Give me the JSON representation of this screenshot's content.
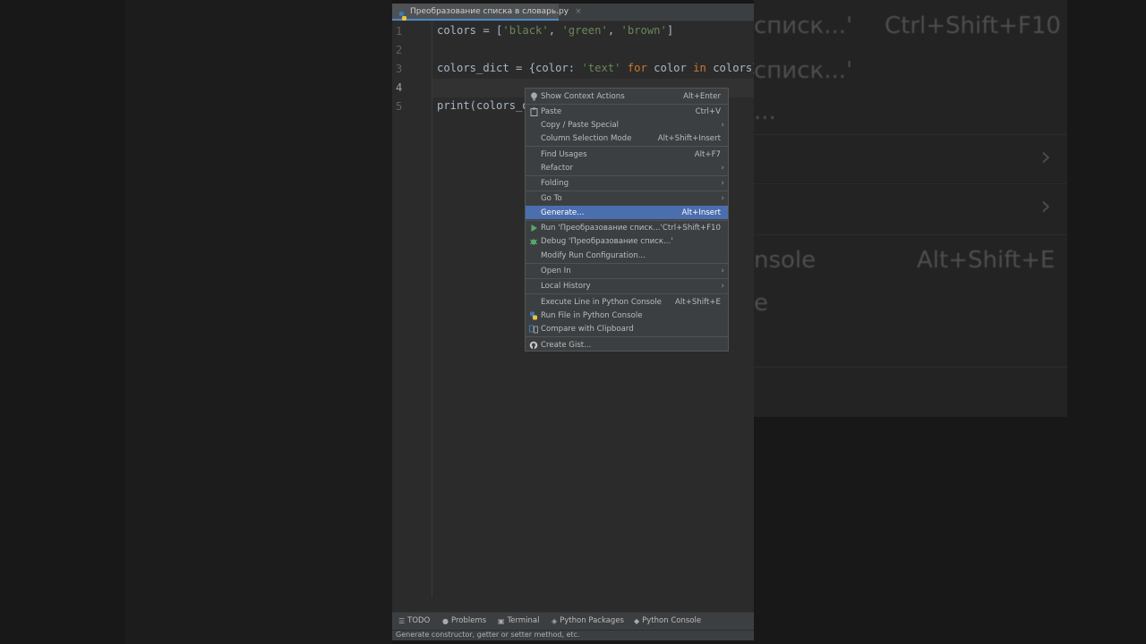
{
  "background": {
    "texts": [
      {
        "text": "списк...'"
      },
      {
        "text": "Ctrl+Shift+F10"
      },
      {
        "text": "списк...'"
      },
      {
        "text": "..."
      },
      {
        "text": "nsole"
      },
      {
        "text": "Alt+Shift+E"
      },
      {
        "text": "e"
      }
    ]
  },
  "editor": {
    "tab_label": "Преобразование списка в словарь.py",
    "tab_close": "×",
    "line_numbers": [
      "1",
      "2",
      "3",
      "4",
      "5"
    ],
    "lines": {
      "l1": {
        "a": "colors = [",
        "s1": "'black'",
        "c1": ", ",
        "s2": "'green'",
        "c2": ", ",
        "s3": "'brown'",
        "b": "]"
      },
      "l3": {
        "a": "colors_dict = {color: ",
        "s1": "'text'",
        "k1": " for ",
        "m": "color",
        "k2": " in ",
        "b": "colors}"
      },
      "l5": {
        "a": "print(colors_d"
      }
    }
  },
  "context_menu": {
    "items": [
      {
        "label": "Show Context Actions",
        "shortcut": "Alt+Enter",
        "icon": "bulb-icon"
      },
      {
        "label": "Paste",
        "shortcut": "Ctrl+V",
        "icon": "paste-icon"
      },
      {
        "label": "Copy / Paste Special",
        "submenu": "›"
      },
      {
        "label": "Column Selection Mode",
        "shortcut": "Alt+Shift+Insert"
      },
      {
        "label": "Find Usages",
        "shortcut": "Alt+F7"
      },
      {
        "label": "Refactor",
        "submenu": "›"
      },
      {
        "label": "Folding",
        "submenu": "›"
      },
      {
        "label": "Go To",
        "submenu": "›"
      },
      {
        "label": "Generate...",
        "shortcut": "Alt+Insert",
        "selected": true
      },
      {
        "label": "Run 'Преобразование списк...'",
        "shortcut": "Ctrl+Shift+F10",
        "icon": "run-icon"
      },
      {
        "label": "Debug 'Преобразование списк...'",
        "icon": "debug-icon"
      },
      {
        "label": "Modify Run Configuration..."
      },
      {
        "label": "Open In",
        "submenu": "›"
      },
      {
        "label": "Local History",
        "submenu": "›"
      },
      {
        "label": "Execute Line in Python Console",
        "shortcut": "Alt+Shift+E"
      },
      {
        "label": "Run File in Python Console",
        "icon": "python-icon"
      },
      {
        "label": "Compare with Clipboard",
        "icon": "compare-icon"
      },
      {
        "label": "Create Gist...",
        "icon": "github-icon"
      }
    ]
  },
  "tool_windows": {
    "todo": "TODO",
    "problems": "Problems",
    "terminal": "Terminal",
    "packages": "Python Packages",
    "console": "Python Console"
  },
  "status": {
    "text": "Generate constructor, getter or setter method, etc."
  },
  "colors": {
    "editor_bg": "#2b2b2b",
    "menu_bg": "#3c3f41",
    "selection": "#4b6eaf",
    "string": "#6a8759",
    "keyword": "#cc7832",
    "text": "#a9b7c6"
  }
}
